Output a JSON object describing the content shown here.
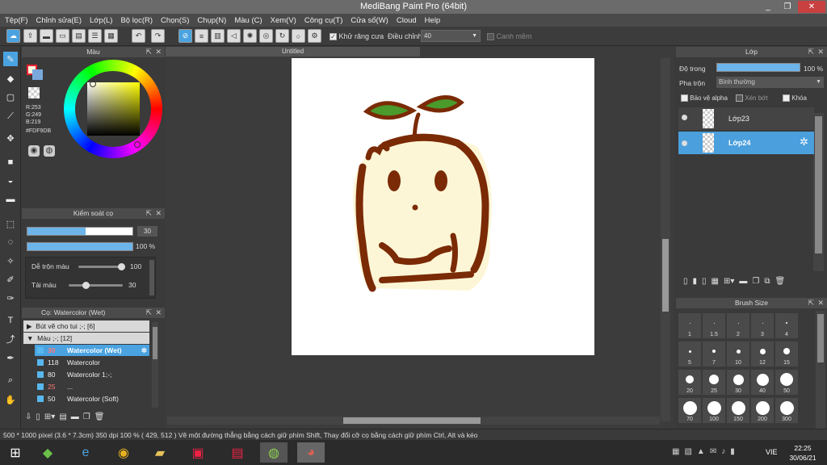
{
  "window": {
    "title": "MediBang Paint Pro (64bit)"
  },
  "menu": [
    "Tệp(F)",
    "Chỉnh sửa(E)",
    "Lớp(L)",
    "Bộ lọc(R)",
    "Chọn(S)",
    "Chụp(N)",
    "Màu (C)",
    "Xem(V)",
    "Công cụ(T)",
    "Cửa sổ(W)",
    "Cloud",
    "Help"
  ],
  "toolbar": {
    "antialias_label": "Khử răng cưa",
    "adjust_label": "Điều chỉnh",
    "adjust_value": "40",
    "smooth_label": "Canh mềm"
  },
  "color_panel": {
    "title": "Màu",
    "r": "R:253",
    "g": "G:249",
    "b": "B:219",
    "hex": "#FDF9DB",
    "fg_color": "#fdf9db"
  },
  "brush_control": {
    "title": "Kiểm soát cọ",
    "size_value": "30",
    "size_fraction": 0.55,
    "opacity_value": "100 %",
    "opacity_fraction": 1.0,
    "blend_label": "Dễ trộn màu",
    "blend_value": "100",
    "amount_label": "Tải màu",
    "amount_value": "30"
  },
  "brush_panel": {
    "title": "Cọ: Watercolor (Wet)",
    "groups": [
      "Bút vẽ cho tui ;-; [6]",
      "Màu ;-; [12]"
    ],
    "brushes": [
      {
        "size": "30",
        "name": "Watercolor (Wet)",
        "selected": true
      },
      {
        "size": "118",
        "name": "Watercolor",
        "selected": false
      },
      {
        "size": "80",
        "name": "Watercolor 1;-;",
        "selected": false
      },
      {
        "size": "25",
        "name": "...",
        "selected": false
      },
      {
        "size": "50",
        "name": "Watercolor (Soft)",
        "selected": false
      }
    ]
  },
  "canvas": {
    "tab": "Untitled"
  },
  "layer_panel": {
    "title": "Lớp",
    "opacity_label": "Độ trong",
    "opacity_value": "100 %",
    "blend_label": "Pha trộn",
    "blend_value": "Bình thường",
    "protect_alpha": "Bảo vệ alpha",
    "clip": "Xén bớt",
    "lock": "Khóa",
    "layers": [
      {
        "name": "Lớp23",
        "selected": false
      },
      {
        "name": "Lớp24",
        "selected": true
      }
    ]
  },
  "brush_size": {
    "title": "Brush Size",
    "sizes": [
      "1",
      "1.5",
      "2",
      "3",
      "4",
      "5",
      "7",
      "10",
      "12",
      "15",
      "20",
      "25",
      "30",
      "40",
      "50",
      "70",
      "100",
      "150",
      "200",
      "300"
    ]
  },
  "status": {
    "text": "500 * 1000 pixel   (3.6 * 7.3cm)   350 dpi   100 %   ( 429, 512 )   Vẽ một đường thẳng bằng cách giữ phím Shift, Thay đổi cỡ cọ bằng cách giữ phím Ctrl, Alt và kéo"
  },
  "taskbar": {
    "lang": "VIE",
    "time": "22:25",
    "date": "30/06/21"
  }
}
